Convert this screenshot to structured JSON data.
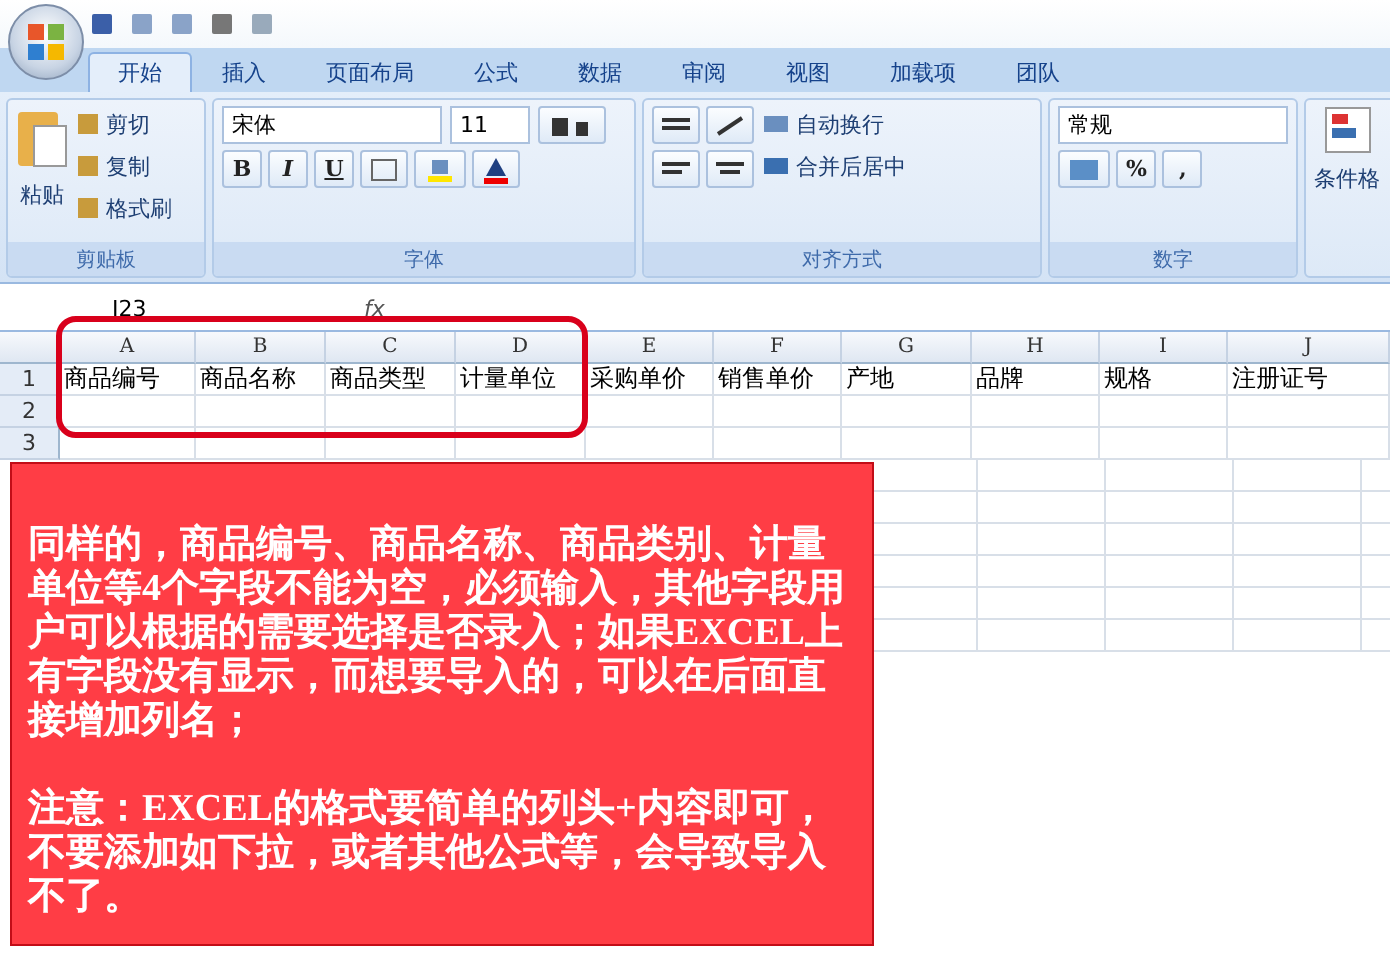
{
  "tabs": [
    {
      "label": "开始",
      "selected": true
    },
    {
      "label": "插入",
      "selected": false
    },
    {
      "label": "页面布局",
      "selected": false
    },
    {
      "label": "公式",
      "selected": false
    },
    {
      "label": "数据",
      "selected": false
    },
    {
      "label": "审阅",
      "selected": false
    },
    {
      "label": "视图",
      "selected": false
    },
    {
      "label": "加载项",
      "selected": false
    },
    {
      "label": "团队",
      "selected": false
    }
  ],
  "clipboard": {
    "title": "剪贴板",
    "paste": "粘贴",
    "items": [
      "剪切",
      "复制",
      "格式刷"
    ]
  },
  "font": {
    "title": "字体",
    "name": "宋体",
    "size": "11",
    "styles": [
      "B",
      "I",
      "U"
    ]
  },
  "alignment": {
    "title": "对齐方式",
    "wrap": "自动换行",
    "merge": "合并后居中"
  },
  "number": {
    "title": "数字",
    "format": "常规",
    "percent": "%",
    "comma": ","
  },
  "styles": {
    "label": "条件格"
  },
  "name_box": "I23",
  "formula_label": "fx",
  "columns": [
    "A",
    "B",
    "C",
    "D",
    "E",
    "F",
    "G",
    "H",
    "I",
    "J"
  ],
  "rows": [
    {
      "number": "1",
      "cells": [
        "商品编号",
        "商品名称",
        "商品类型",
        "计量单位",
        "采购单价",
        "销售单价",
        "产地",
        "品牌",
        "规格",
        "注册证号"
      ]
    },
    {
      "number": "2"
    },
    {
      "number": "3"
    }
  ],
  "callout": {
    "paragraphs": [
      "同样的，商品编号、商品名称、商品类别、计量单位等4个字段不能为空，必须输入，其他字段用户可以根据的需要选择是否录入；如果EXCEL上有字段没有显示，而想要导入的，可以在后面直接增加列名；",
      "注意：EXCEL的格式要简单的列头+内容即可，不要添加如下拉，或者其他公式等，会导致导入不了。"
    ]
  }
}
